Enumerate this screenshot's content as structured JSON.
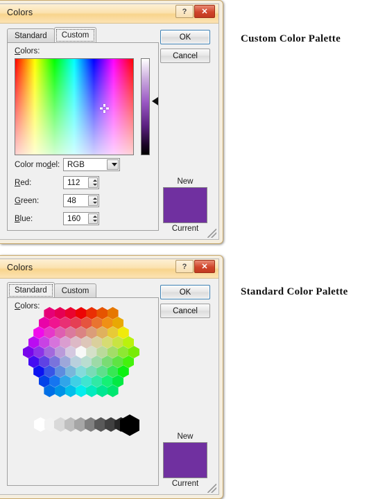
{
  "annotations": {
    "custom": "Custom Color Palette",
    "standard": "Standard Color Palette"
  },
  "custom_dialog": {
    "title": "Colors",
    "titlebar_buttons": {
      "help": "?",
      "close": "✕"
    },
    "tabs": [
      {
        "label": "Standard",
        "active": false
      },
      {
        "label": "Custom",
        "active": true
      }
    ],
    "colors_label": "Colors:",
    "color_model_label": "Color model:",
    "color_model_value": "RGB",
    "channels": [
      {
        "label": "Red:",
        "value": "112"
      },
      {
        "label": "Green:",
        "value": "48"
      },
      {
        "label": "Blue:",
        "value": "160"
      }
    ],
    "buttons": {
      "ok": "OK",
      "cancel": "Cancel"
    },
    "preview": {
      "new_label": "New",
      "current_label": "Current",
      "color": "#7030A0"
    }
  },
  "standard_dialog": {
    "title": "Colors",
    "titlebar_buttons": {
      "help": "?",
      "close": "✕"
    },
    "tabs": [
      {
        "label": "Standard",
        "active": true
      },
      {
        "label": "Custom",
        "active": false
      }
    ],
    "colors_label": "Colors:",
    "buttons": {
      "ok": "OK",
      "cancel": "Cancel"
    },
    "preview": {
      "new_label": "New",
      "current_label": "Current",
      "color": "#7030A0"
    },
    "grayscale": [
      "#ffffff",
      "#f2f2f2",
      "#d9d9d9",
      "#bfbfbf",
      "#a6a6a6",
      "#808080",
      "#595959",
      "#404040",
      "#262626"
    ],
    "black_swatch": "#000000"
  }
}
